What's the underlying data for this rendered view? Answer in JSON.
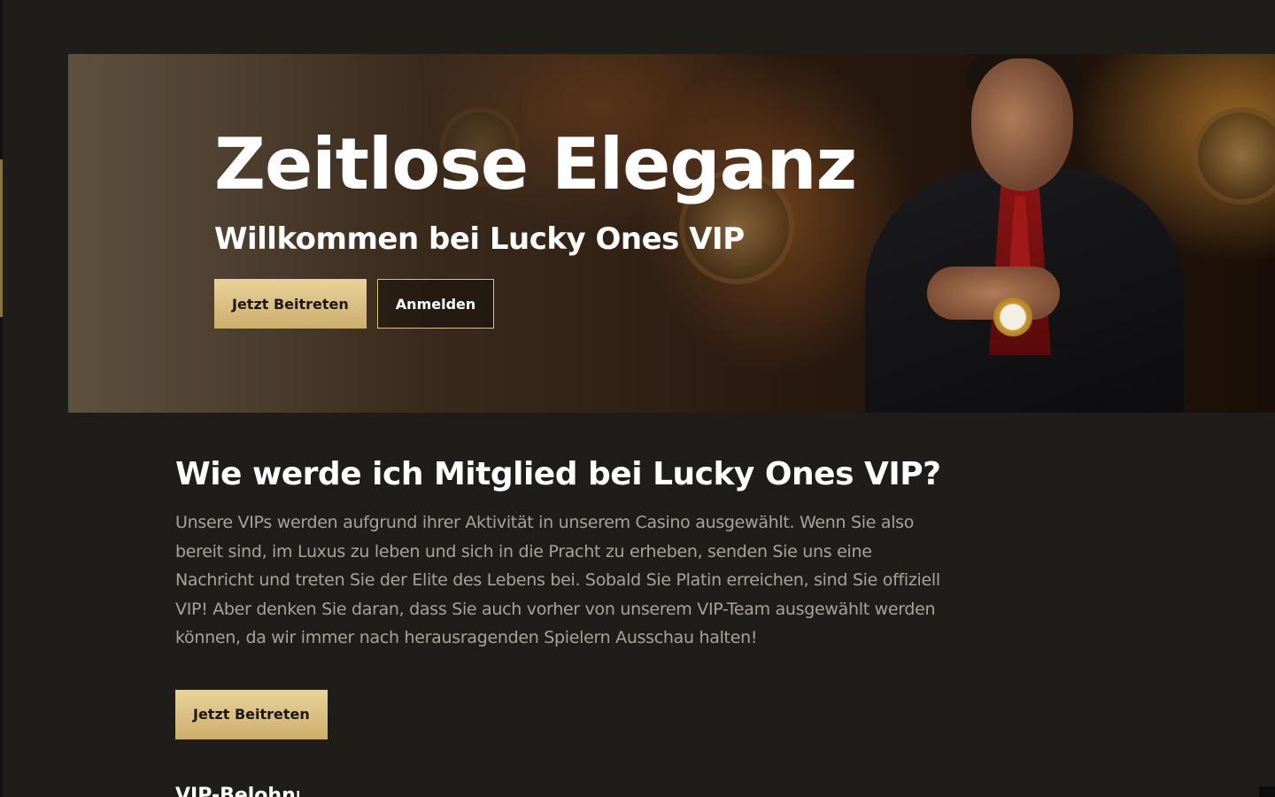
{
  "hero": {
    "title": "Zeitlose Eleganz",
    "subtitle": "Willkommen bei Lucky Ones VIP",
    "primary_button": "Jetzt Beitreten",
    "secondary_button": "Anmelden"
  },
  "membership": {
    "title": "Wie werde ich Mitglied bei Lucky Ones VIP?",
    "text": "Unsere VIPs werden aufgrund ihrer Aktivität in unserem Casino ausgewählt. Wenn Sie also bereit sind, im Luxus zu leben und sich in die Pracht zu erheben, senden Sie uns eine Nachricht und treten Sie der Elite des Lebens bei. Sobald Sie Platin erreichen, sind Sie offiziell VIP! Aber denken Sie daran, dass Sie auch vorher von unserem VIP-Team ausgewählt werden können, da wir immer nach herausragenden Spielern Ausschau halten!",
    "button": "Jetzt Beitreten"
  },
  "next_section": {
    "title": "VIP-Belohnungen"
  },
  "colors": {
    "background": "#1f1d1a",
    "gold": "#d8bd82",
    "text_muted": "#a8a39a",
    "heading": "#ffffff"
  }
}
